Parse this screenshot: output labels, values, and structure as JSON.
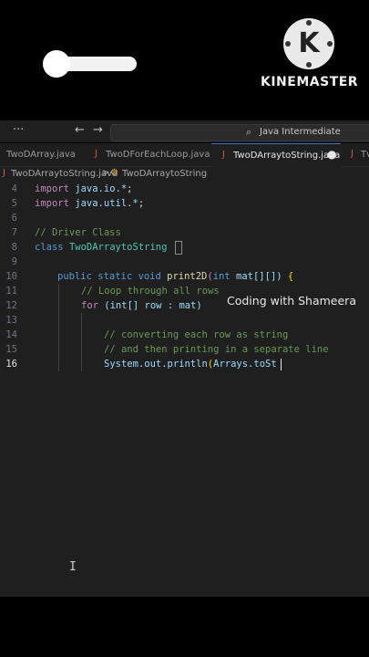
{
  "kinemaster": {
    "logo_letter": "K",
    "brand_text": "KINEMASTER",
    "logo_icon": "kinemaster-logo-icon"
  },
  "titlebar": {
    "menu_dots": "···",
    "back_arrow": "←",
    "forward_arrow": "→",
    "search_icon": "search-icon",
    "search_text": "Java Intermediate"
  },
  "tabs": [
    {
      "label": "TwoDArray.java"
    },
    {
      "label": "TwoDForEachLoop.java"
    },
    {
      "label": "TwoDArraytoString.java",
      "active": true,
      "modified": "●"
    },
    {
      "label": "Tv"
    }
  ],
  "breadcrumb": {
    "file": "TwoDArraytoString.java",
    "separator": ">",
    "class_name": "TwoDArraytoString"
  },
  "editor": {
    "lines": [
      {
        "n": "4"
      },
      {
        "n": "5"
      },
      {
        "n": "6"
      },
      {
        "n": "7"
      },
      {
        "n": "8"
      },
      {
        "n": "9"
      },
      {
        "n": "10"
      },
      {
        "n": "11"
      },
      {
        "n": "12"
      },
      {
        "n": "13"
      },
      {
        "n": "14"
      },
      {
        "n": "15"
      },
      {
        "n": "16"
      }
    ],
    "tokens": {
      "import": "import",
      "java_io": "java.io.*",
      "java_util": "java.util.*",
      "semi": ";",
      "comment_driver": "// Driver Class",
      "class_kw": "class",
      "class_name": "TwoDArraytoString",
      "public_static_void": "public static void",
      "print2d": "print2D",
      "paren_open": "(",
      "int_kw": "int",
      "mat_param": " mat[][])",
      "brace_open": " {",
      "comment_loop": "// Loop through all rows",
      "for_kw": "for",
      "for_rest": " (int[] row : mat)",
      "comment_convert": "// converting each row as string",
      "comment_print": "// and then printing in a separate line",
      "println": "System.out.println",
      "println_paren": "(",
      "arrays_tost": "Arrays.toSt"
    }
  },
  "watermark": "Coding with Shameera",
  "ibeam": "I"
}
